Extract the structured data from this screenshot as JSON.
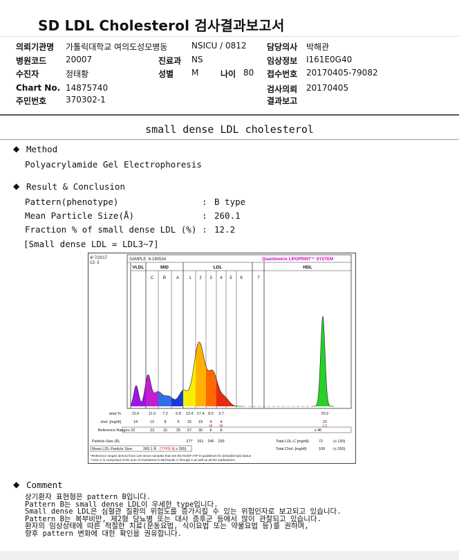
{
  "report": {
    "title": "SD LDL Cholesterol 검사결과보고서",
    "fields": {
      "institution_label": "의뢰기관명",
      "institution_value": "가톨릭대학교 여의도성모병동",
      "ward_value": "NSICU / 0812",
      "doctor_label": "담당의사",
      "doctor_value": "박해관",
      "hospital_code_label": "병원코드",
      "hospital_code_value": "20007",
      "dept_label": "진료과",
      "dept_value": "NS",
      "clinical_label": "임상정보",
      "clinical_value": "I161E0G40",
      "patient_label": "수진자",
      "patient_value": "정태황",
      "sex_label": "성별",
      "sex_value": "M",
      "age_label": "나이",
      "age_value": "80",
      "receipt_label": "접수번호",
      "receipt_value": "20170405-79082",
      "chart_label": "Chart No.",
      "chart_value": "14875740",
      "request_label": "검사의뢰",
      "request_value": "20170405",
      "rrn_label": "주민번호",
      "rrn_value": "370302-1",
      "result_report_label": "결과보고"
    }
  },
  "section_title": "small dense LDL cholesterol",
  "method": {
    "heading": "Method",
    "value": "Polyacrylamide Gel Electrophoresis"
  },
  "result": {
    "heading": "Result & Conclusion",
    "rows": [
      {
        "label": "Pattern(phenotype)",
        "value": "B type"
      },
      {
        "label": "Mean Particle Size(Å)",
        "value": "260.1"
      },
      {
        "label": "Fraction % of small dense LDL (%)",
        "value": "12.2"
      }
    ],
    "note": "[Small dense LDL = LDL3~7]"
  },
  "chart_data": {
    "type": "area",
    "date": "4/ 7/2017",
    "time": "13: 3",
    "sample": "SAMPLE:   6-190534",
    "brand": "Quantimetrix LIPOPRINT™ SYSTEM",
    "band_groups": [
      "VLDL",
      "MID",
      "LDL",
      "HDL"
    ],
    "bands": [
      "C",
      "B",
      "A",
      "1",
      "2",
      "3",
      "4",
      "5",
      "6",
      "7"
    ],
    "area_label": "area %",
    "area_values": [
      "12.6",
      "11.0",
      "7.2",
      "5.8",
      "13.4",
      "17.4",
      "8.5",
      "3.7",
      "20.2"
    ],
    "chol_label": "chol. [mg/dl]",
    "chol_values": [
      "14",
      "12",
      "8",
      "5",
      "15",
      "19",
      "9",
      "4",
      "22"
    ],
    "hi_flags": [
      "HI",
      "HI"
    ],
    "lo_flag": "LO",
    "ref_label": "Reference Range",
    "ref_values": [
      "≤ 22",
      "23",
      "15",
      "25",
      "57",
      "30",
      "6",
      "8",
      "≥ 40"
    ],
    "particle_size_label": "Particle-Size (Å)",
    "particle_sizes": [
      "277",
      "261",
      "245",
      "230"
    ],
    "mean_ldl_label": "Mean LDL-Particle Size:",
    "mean_ldl_value": "260.1 Å",
    "type_text": "(TYPE B",
    "type_ref": "; ≥ 265)",
    "total_ldl_label": "Total LDL-C [mg/dl]:",
    "total_ldl_value": "72",
    "total_ldl_ref": "(≤ 130)",
    "total_chol_label": "Total Chol. [mg/dl]:",
    "total_chol_value": "109",
    "total_chol_ref": "(≤ 200)",
    "footnote1": "*Reference ranges derived from 125 serum samples that met the NCEP ATP III guidelines for desirable lipid status",
    "footnote2": "**LDL-C is comprised of the sum of cholesterol in Mid bands C through A as well as all the subfractions",
    "colors": {
      "vldl": "#9b17e6",
      "mid_c": "#c21fd0",
      "mid_b": "#2f6fe8",
      "mid_a": "#1a3ad8",
      "ldl1": "#f5f000",
      "ldl2": "#ffb000",
      "ldl3": "#ff6a00",
      "ldl4": "#e82a10",
      "hdl": "#28d028",
      "flag": "#e01010",
      "brand": "#d400c8"
    }
  },
  "comment": {
    "heading": "Comment",
    "lines": [
      "상기환자 표현형은 pattern B입니다.",
      "Pattern B는 small dense LDL이 우세한 type입니다.",
      "Small dense LDL은 심혈관 질환의 위험도를 증가시킬 수 있는 위험인자로 보고되고 있습니다.",
      "Pattern B는 복부비만, 제2형 당뇨병 또는 대사 증후군 등에서 많이 관찰되고 있습니다.",
      "환자의 임상상태에 따른 적절한 치료(운동요법, 식이요법 또는 약물요법 등)를 권하며,",
      "향후 pattern 변화에 대한 확인을 권유합니다."
    ]
  }
}
